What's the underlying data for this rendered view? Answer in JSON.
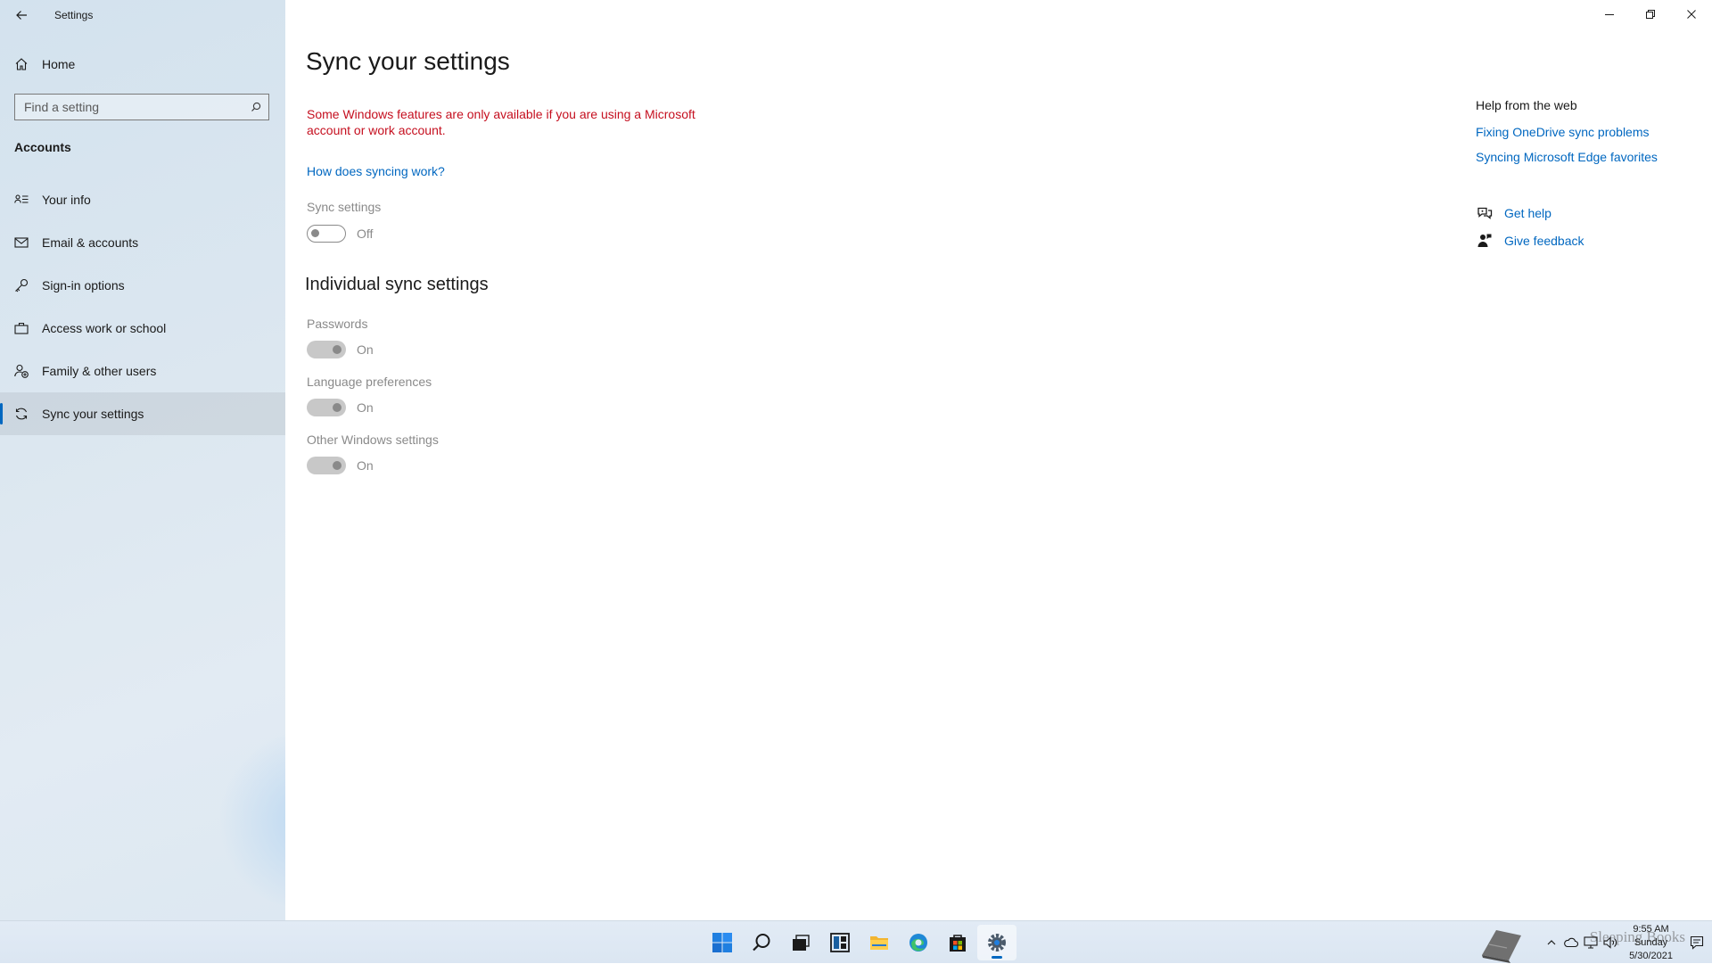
{
  "window": {
    "app_title": "Settings",
    "controls": {
      "minimize": "minimize",
      "restore": "restore",
      "close": "close"
    }
  },
  "sidebar": {
    "home_label": "Home",
    "search": {
      "placeholder": "Find a setting",
      "value": ""
    },
    "section_title": "Accounts",
    "items": [
      {
        "label": "Your info",
        "icon": "person-card-icon",
        "selected": false
      },
      {
        "label": "Email & accounts",
        "icon": "mail-icon",
        "selected": false
      },
      {
        "label": "Sign-in options",
        "icon": "key-icon",
        "selected": false
      },
      {
        "label": "Access work or school",
        "icon": "briefcase-icon",
        "selected": false
      },
      {
        "label": "Family & other users",
        "icon": "add-person-icon",
        "selected": false
      },
      {
        "label": "Sync your settings",
        "icon": "sync-icon",
        "selected": true
      }
    ]
  },
  "main": {
    "title": "Sync your settings",
    "warning": "Some Windows features are only available if you are using a Microsoft account or work account.",
    "how_link": "How does syncing work?",
    "sync_settings": {
      "label": "Sync settings",
      "state": "Off",
      "enabled": false
    },
    "individual_title": "Individual sync settings",
    "individual": [
      {
        "label": "Passwords",
        "state": "On"
      },
      {
        "label": "Language preferences",
        "state": "On"
      },
      {
        "label": "Other Windows settings",
        "state": "On"
      }
    ]
  },
  "help": {
    "heading": "Help from the web",
    "links": [
      "Fixing OneDrive sync problems",
      "Syncing Microsoft Edge favorites"
    ],
    "get_help": "Get help",
    "give_feedback": "Give feedback"
  },
  "taskbar": {
    "apps": [
      "start-icon",
      "search-icon",
      "task-view-icon",
      "widgets-icon",
      "file-explorer-icon",
      "edge-icon",
      "store-icon",
      "settings-icon"
    ],
    "active_app": "settings-icon",
    "clock": {
      "time": "9:55 AM",
      "day": "Sunday",
      "date": "5/30/2021"
    },
    "watermark": "Sleeping Books"
  },
  "colors": {
    "accent": "#0067c0",
    "warning": "#c50f1f",
    "disabled": "#8a8a8a"
  }
}
